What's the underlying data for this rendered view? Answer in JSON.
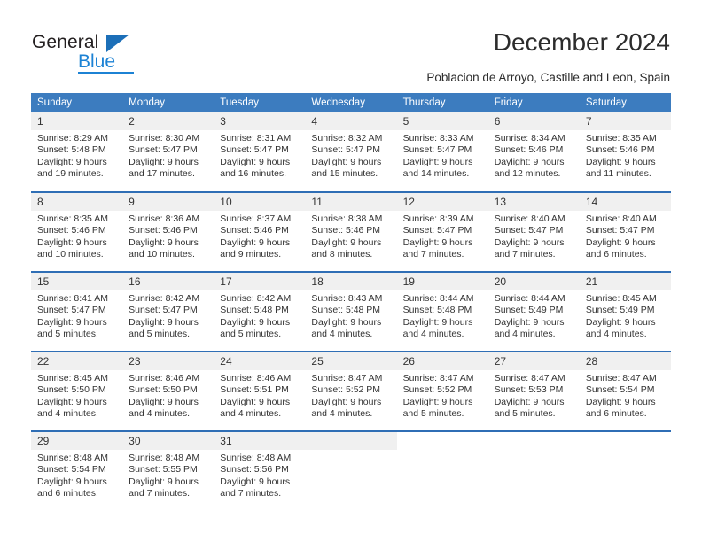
{
  "brand": {
    "name_top": "General",
    "name_bottom": "Blue",
    "accent_color": "#1c82d4",
    "triangle_color": "#1c6fb8"
  },
  "header": {
    "title": "December 2024",
    "subtitle": "Poblacion de Arroyo, Castille and Leon, Spain"
  },
  "calendar": {
    "header_bg": "#3c7cbf",
    "daynum_bg": "#f0f0f0",
    "week_separator_color": "#2f6eb5",
    "weekday_headers": [
      "Sunday",
      "Monday",
      "Tuesday",
      "Wednesday",
      "Thursday",
      "Friday",
      "Saturday"
    ],
    "weeks": [
      [
        {
          "day": "1",
          "sunrise": "Sunrise: 8:29 AM",
          "sunset": "Sunset: 5:48 PM",
          "daylight1": "Daylight: 9 hours",
          "daylight2": "and 19 minutes."
        },
        {
          "day": "2",
          "sunrise": "Sunrise: 8:30 AM",
          "sunset": "Sunset: 5:47 PM",
          "daylight1": "Daylight: 9 hours",
          "daylight2": "and 17 minutes."
        },
        {
          "day": "3",
          "sunrise": "Sunrise: 8:31 AM",
          "sunset": "Sunset: 5:47 PM",
          "daylight1": "Daylight: 9 hours",
          "daylight2": "and 16 minutes."
        },
        {
          "day": "4",
          "sunrise": "Sunrise: 8:32 AM",
          "sunset": "Sunset: 5:47 PM",
          "daylight1": "Daylight: 9 hours",
          "daylight2": "and 15 minutes."
        },
        {
          "day": "5",
          "sunrise": "Sunrise: 8:33 AM",
          "sunset": "Sunset: 5:47 PM",
          "daylight1": "Daylight: 9 hours",
          "daylight2": "and 14 minutes."
        },
        {
          "day": "6",
          "sunrise": "Sunrise: 8:34 AM",
          "sunset": "Sunset: 5:46 PM",
          "daylight1": "Daylight: 9 hours",
          "daylight2": "and 12 minutes."
        },
        {
          "day": "7",
          "sunrise": "Sunrise: 8:35 AM",
          "sunset": "Sunset: 5:46 PM",
          "daylight1": "Daylight: 9 hours",
          "daylight2": "and 11 minutes."
        }
      ],
      [
        {
          "day": "8",
          "sunrise": "Sunrise: 8:35 AM",
          "sunset": "Sunset: 5:46 PM",
          "daylight1": "Daylight: 9 hours",
          "daylight2": "and 10 minutes."
        },
        {
          "day": "9",
          "sunrise": "Sunrise: 8:36 AM",
          "sunset": "Sunset: 5:46 PM",
          "daylight1": "Daylight: 9 hours",
          "daylight2": "and 10 minutes."
        },
        {
          "day": "10",
          "sunrise": "Sunrise: 8:37 AM",
          "sunset": "Sunset: 5:46 PM",
          "daylight1": "Daylight: 9 hours",
          "daylight2": "and 9 minutes."
        },
        {
          "day": "11",
          "sunrise": "Sunrise: 8:38 AM",
          "sunset": "Sunset: 5:46 PM",
          "daylight1": "Daylight: 9 hours",
          "daylight2": "and 8 minutes."
        },
        {
          "day": "12",
          "sunrise": "Sunrise: 8:39 AM",
          "sunset": "Sunset: 5:47 PM",
          "daylight1": "Daylight: 9 hours",
          "daylight2": "and 7 minutes."
        },
        {
          "day": "13",
          "sunrise": "Sunrise: 8:40 AM",
          "sunset": "Sunset: 5:47 PM",
          "daylight1": "Daylight: 9 hours",
          "daylight2": "and 7 minutes."
        },
        {
          "day": "14",
          "sunrise": "Sunrise: 8:40 AM",
          "sunset": "Sunset: 5:47 PM",
          "daylight1": "Daylight: 9 hours",
          "daylight2": "and 6 minutes."
        }
      ],
      [
        {
          "day": "15",
          "sunrise": "Sunrise: 8:41 AM",
          "sunset": "Sunset: 5:47 PM",
          "daylight1": "Daylight: 9 hours",
          "daylight2": "and 5 minutes."
        },
        {
          "day": "16",
          "sunrise": "Sunrise: 8:42 AM",
          "sunset": "Sunset: 5:47 PM",
          "daylight1": "Daylight: 9 hours",
          "daylight2": "and 5 minutes."
        },
        {
          "day": "17",
          "sunrise": "Sunrise: 8:42 AM",
          "sunset": "Sunset: 5:48 PM",
          "daylight1": "Daylight: 9 hours",
          "daylight2": "and 5 minutes."
        },
        {
          "day": "18",
          "sunrise": "Sunrise: 8:43 AM",
          "sunset": "Sunset: 5:48 PM",
          "daylight1": "Daylight: 9 hours",
          "daylight2": "and 4 minutes."
        },
        {
          "day": "19",
          "sunrise": "Sunrise: 8:44 AM",
          "sunset": "Sunset: 5:48 PM",
          "daylight1": "Daylight: 9 hours",
          "daylight2": "and 4 minutes."
        },
        {
          "day": "20",
          "sunrise": "Sunrise: 8:44 AM",
          "sunset": "Sunset: 5:49 PM",
          "daylight1": "Daylight: 9 hours",
          "daylight2": "and 4 minutes."
        },
        {
          "day": "21",
          "sunrise": "Sunrise: 8:45 AM",
          "sunset": "Sunset: 5:49 PM",
          "daylight1": "Daylight: 9 hours",
          "daylight2": "and 4 minutes."
        }
      ],
      [
        {
          "day": "22",
          "sunrise": "Sunrise: 8:45 AM",
          "sunset": "Sunset: 5:50 PM",
          "daylight1": "Daylight: 9 hours",
          "daylight2": "and 4 minutes."
        },
        {
          "day": "23",
          "sunrise": "Sunrise: 8:46 AM",
          "sunset": "Sunset: 5:50 PM",
          "daylight1": "Daylight: 9 hours",
          "daylight2": "and 4 minutes."
        },
        {
          "day": "24",
          "sunrise": "Sunrise: 8:46 AM",
          "sunset": "Sunset: 5:51 PM",
          "daylight1": "Daylight: 9 hours",
          "daylight2": "and 4 minutes."
        },
        {
          "day": "25",
          "sunrise": "Sunrise: 8:47 AM",
          "sunset": "Sunset: 5:52 PM",
          "daylight1": "Daylight: 9 hours",
          "daylight2": "and 4 minutes."
        },
        {
          "day": "26",
          "sunrise": "Sunrise: 8:47 AM",
          "sunset": "Sunset: 5:52 PM",
          "daylight1": "Daylight: 9 hours",
          "daylight2": "and 5 minutes."
        },
        {
          "day": "27",
          "sunrise": "Sunrise: 8:47 AM",
          "sunset": "Sunset: 5:53 PM",
          "daylight1": "Daylight: 9 hours",
          "daylight2": "and 5 minutes."
        },
        {
          "day": "28",
          "sunrise": "Sunrise: 8:47 AM",
          "sunset": "Sunset: 5:54 PM",
          "daylight1": "Daylight: 9 hours",
          "daylight2": "and 6 minutes."
        }
      ],
      [
        {
          "day": "29",
          "sunrise": "Sunrise: 8:48 AM",
          "sunset": "Sunset: 5:54 PM",
          "daylight1": "Daylight: 9 hours",
          "daylight2": "and 6 minutes."
        },
        {
          "day": "30",
          "sunrise": "Sunrise: 8:48 AM",
          "sunset": "Sunset: 5:55 PM",
          "daylight1": "Daylight: 9 hours",
          "daylight2": "and 7 minutes."
        },
        {
          "day": "31",
          "sunrise": "Sunrise: 8:48 AM",
          "sunset": "Sunset: 5:56 PM",
          "daylight1": "Daylight: 9 hours",
          "daylight2": "and 7 minutes."
        },
        {
          "day": "",
          "sunrise": "",
          "sunset": "",
          "daylight1": "",
          "daylight2": ""
        },
        {
          "day": "",
          "sunrise": "",
          "sunset": "",
          "daylight1": "",
          "daylight2": ""
        },
        {
          "day": "",
          "sunrise": "",
          "sunset": "",
          "daylight1": "",
          "daylight2": ""
        },
        {
          "day": "",
          "sunrise": "",
          "sunset": "",
          "daylight1": "",
          "daylight2": ""
        }
      ]
    ]
  }
}
